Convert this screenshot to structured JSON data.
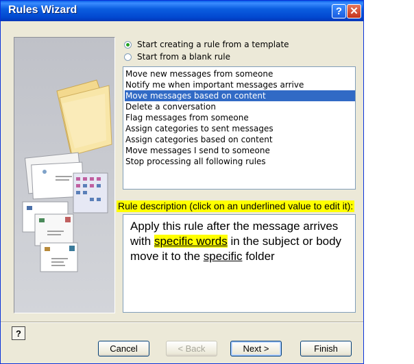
{
  "window": {
    "title": "Rules Wizard",
    "help_glyph": "?",
    "close_glyph": "✕"
  },
  "options": [
    {
      "label": "Start creating a rule from a template",
      "selected": true
    },
    {
      "label": "Start from a blank rule",
      "selected": false
    }
  ],
  "templates": {
    "items": [
      "Move new messages from someone",
      "Notify me when important messages arrive",
      "Move messages based on content",
      "Delete a conversation",
      "Flag messages from someone",
      "Assign categories to sent messages",
      "Assign categories based on content",
      "Move messages I send to someone",
      "Stop processing all following rules"
    ],
    "selected_index": 2
  },
  "description": {
    "label": "Rule description (click on an underlined value to edit it):",
    "line1": "Apply this rule after the message arrives",
    "line2_prefix": "with ",
    "line2_link": "specific words",
    "line2_suffix": " in the subject or body",
    "line3_prefix": "move it to the ",
    "line3_link": "specific",
    "line3_suffix": " folder"
  },
  "footer": {
    "help_icon": "question-mark-icon",
    "help_glyph": "?",
    "cancel": "Cancel",
    "back": "< Back",
    "next": "Next >",
    "finish": "Finish"
  },
  "colors": {
    "selection": "#316ac5",
    "highlight": "#ffff00",
    "titlebar": "#0b5ee0",
    "dialog": "#ece9d8"
  }
}
